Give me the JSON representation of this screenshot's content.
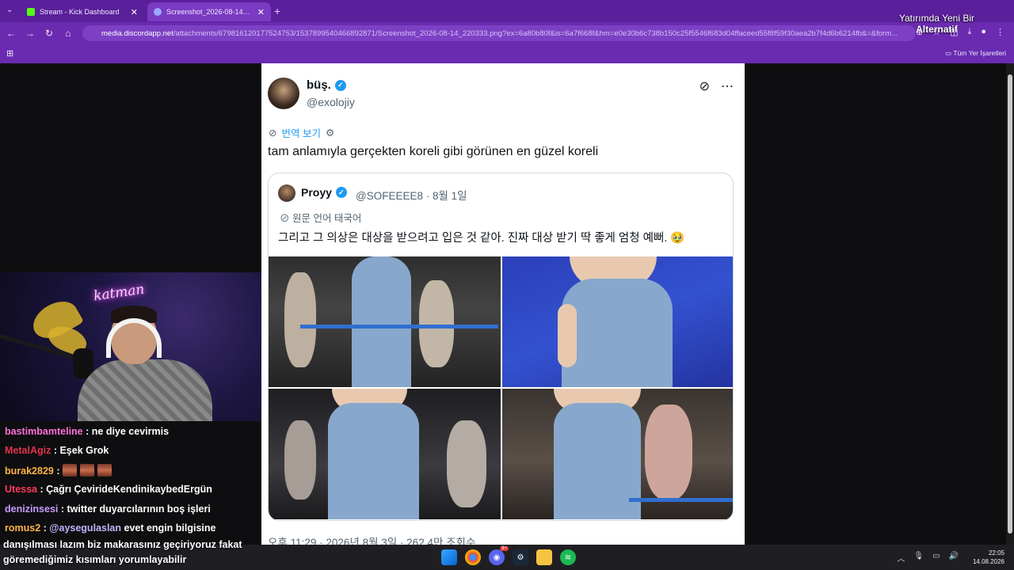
{
  "browser": {
    "tabs": [
      {
        "label": "Stream - Kick Dashboard",
        "icon_color": "#53fc18"
      },
      {
        "label": "Screenshot_2026-08-14_220333",
        "icon_color": "#9aa6ff"
      }
    ],
    "url_host": "media.discordapp.net",
    "url_path": "/attachments/679816120177524753/1537899540466892871/Screenshot_2026-08-14_220333.png?ex=6a80b80f&is=6a7f668f&hm=e0e30b6c738b150c25f5546f683d04ffaceed55f8f59f30aea2b7f4d6b6214fb&=&form...",
    "bookmarks_label": "Tüm Yer İşaretleri",
    "overlay_title_line1": "Yatırımda Yeni Bir",
    "overlay_title_line2": "Alternatif"
  },
  "tweet": {
    "name": "büş.",
    "handle": "@exolojiy",
    "translate_label": "번역 보기",
    "text": "tam anlamıyla gerçekten koreli gibi görünen en güzel koreli",
    "quote": {
      "name": "Proyy",
      "handle": "@SOFEEEE8 · 8월 1일",
      "lang": "원문 언어 태국어",
      "text": "그리고 그 의상은 대상을 받으려고 입은 것 같아. 진짜 대상 받기 딱 좋게 엄청 예뻐. 🥹"
    },
    "meta": "오후 11:29 · 2026년 8월 3일 · 262.4만 조회수"
  },
  "stream": {
    "neon_sign": "katman"
  },
  "chat": [
    {
      "user": "bastimbamteline",
      "color": "#ff6fd8",
      "text": ": ne diye cevirmis"
    },
    {
      "user": "MetalAgiz",
      "color": "#e0344a",
      "text": ": Eşek Grok"
    },
    {
      "user": "burak2829",
      "color": "#ffb347",
      "text": ":",
      "emotes": 3
    },
    {
      "user": "Utessa",
      "color": "#ff3b5c",
      "text": ": Çağrı ÇevirideKendinikaybedErgün"
    },
    {
      "user": "denizinsesi",
      "color": "#c79bff",
      "text": ": twitter duyarcılarının boş işleri"
    },
    {
      "user": "romus2",
      "color": "#ffb347",
      "text": ":",
      "mention": "@aysegulaslan",
      "text2": " evet engin bilgisine"
    },
    {
      "line": "danışılması lazım biz makarasınız geçiriyoruz fakat"
    },
    {
      "line": "göremediğimiz kısımları yorumlayabilir"
    }
  ],
  "taskbar": {
    "time": "22:05",
    "date": "14.08.2026",
    "badge": "9+"
  }
}
